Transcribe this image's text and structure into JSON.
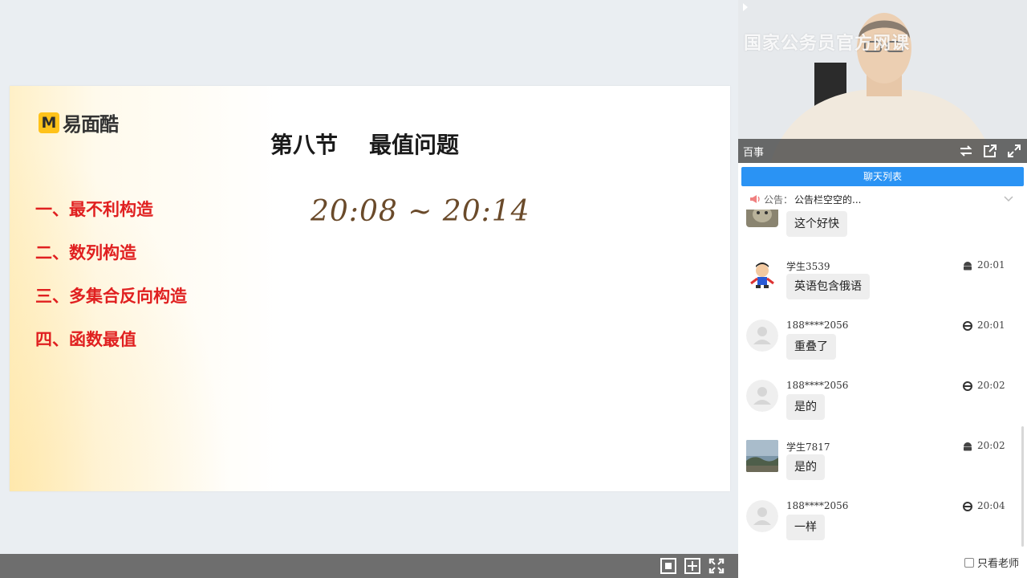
{
  "slide": {
    "logo_badge": "M",
    "logo_text": "易面酷",
    "title": "第八节    最值问题",
    "outline": [
      "一、最不利构造",
      "二、数列构造",
      "三、多集合反向构造",
      "四、函数最值"
    ],
    "handwriting": "20:08 ~ 20:14"
  },
  "video": {
    "watermark": "国家公务员官方网课",
    "name": "百事"
  },
  "chat": {
    "tab_label": "聊天列表",
    "notice_label": "公告：",
    "notice_text": "公告栏空空的...",
    "only_teacher_label": "只看老师",
    "messages": [
      {
        "user": "",
        "source": "",
        "time": "",
        "text": "这个好快",
        "avatar": "photo-cat"
      },
      {
        "user": "学生3539",
        "source": "android",
        "time": "20:01",
        "text": "英语包含俄语",
        "avatar": "cartoon"
      },
      {
        "user": "188****2056",
        "source": "ie",
        "time": "20:01",
        "text": "重叠了",
        "avatar": "default"
      },
      {
        "user": "188****2056",
        "source": "ie",
        "time": "20:02",
        "text": "是的",
        "avatar": "default"
      },
      {
        "user": "学生7817",
        "source": "android",
        "time": "20:02",
        "text": "是的",
        "avatar": "photo-sky"
      },
      {
        "user": "188****2056",
        "source": "ie",
        "time": "20:04",
        "text": "一样",
        "avatar": "default"
      }
    ]
  },
  "colors": {
    "accent_blue": "#2a93f4",
    "outline_red": "#e02020",
    "logo_yellow": "#ffc21a"
  }
}
